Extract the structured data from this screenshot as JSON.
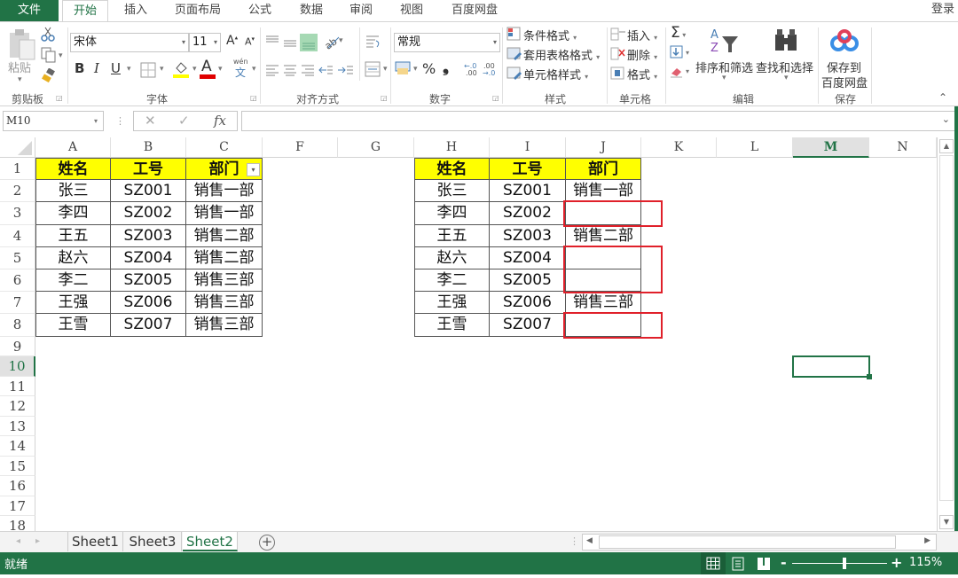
{
  "tabs": {
    "file": "文件",
    "items": [
      "开始",
      "插入",
      "页面布局",
      "公式",
      "数据",
      "审阅",
      "视图",
      "百度网盘"
    ],
    "active_index": 0,
    "login": "登录"
  },
  "ribbon": {
    "clipboard": {
      "paste": "粘贴",
      "label": "剪贴板"
    },
    "font": {
      "name": "宋体",
      "size": "11",
      "bold": "B",
      "italic": "I",
      "underline": "U",
      "label": "字体",
      "phonetic_top": "wén",
      "phonetic_bottom": "文",
      "grow": "A",
      "shrink": "A",
      "font_color_letter": "A"
    },
    "alignment": {
      "label": "对齐方式"
    },
    "number": {
      "format": "常规",
      "percent": "%",
      "comma": "❟",
      "label": "数字"
    },
    "styles": {
      "conditional": "条件格式",
      "table": "套用表格格式",
      "cell": "单元格样式",
      "label": "样式"
    },
    "cells": {
      "insert": "插入",
      "delete": "删除",
      "format": "格式",
      "label": "单元格"
    },
    "editing": {
      "sum": "Σ",
      "sort_filter": "排序和筛选",
      "find_select": "查找和选择",
      "label": "编辑"
    },
    "save": {
      "line1": "保存到",
      "line2": "百度网盘",
      "label": "保存"
    },
    "colors": {
      "highlight": "#ffff00",
      "font_color": "#e00000",
      "accent": "#217346"
    }
  },
  "formula_bar": {
    "name_box": "M10",
    "cancel": "✕",
    "enter": "✓",
    "fx": "fx",
    "value": ""
  },
  "columns": [
    "A",
    "B",
    "C",
    "F",
    "G",
    "H",
    "I",
    "J",
    "K",
    "L",
    "M",
    "N"
  ],
  "selected_column": "M",
  "rows": [
    "1",
    "2",
    "3",
    "4",
    "5",
    "6",
    "7",
    "8",
    "9",
    "10",
    "11",
    "12",
    "13",
    "14",
    "15",
    "16",
    "17",
    "18"
  ],
  "selected_row": "10",
  "table_left": {
    "headers": [
      "姓名",
      "工号",
      "部门"
    ],
    "rows": [
      [
        "张三",
        "SZ001",
        "销售一部"
      ],
      [
        "李四",
        "SZ002",
        "销售一部"
      ],
      [
        "王五",
        "SZ003",
        "销售二部"
      ],
      [
        "赵六",
        "SZ004",
        "销售二部"
      ],
      [
        "李二",
        "SZ005",
        "销售三部"
      ],
      [
        "王强",
        "SZ006",
        "销售三部"
      ],
      [
        "王雪",
        "SZ007",
        "销售三部"
      ]
    ],
    "filter_column": "部门"
  },
  "table_right": {
    "headers": [
      "姓名",
      "工号",
      "部门"
    ],
    "rows": [
      [
        "张三",
        "SZ001",
        "销售一部"
      ],
      [
        "李四",
        "SZ002",
        ""
      ],
      [
        "王五",
        "SZ003",
        "销售二部"
      ],
      [
        "赵六",
        "SZ004",
        ""
      ],
      [
        "李二",
        "SZ005",
        ""
      ],
      [
        "王强",
        "SZ006",
        "销售三部"
      ],
      [
        "王雪",
        "SZ007",
        ""
      ]
    ],
    "highlight_color": "#e0202a"
  },
  "sheets": {
    "items": [
      "Sheet1",
      "Sheet3",
      "Sheet2"
    ],
    "active": "Sheet2",
    "add": "+"
  },
  "status": {
    "ready": "就绪",
    "zoom": "115%",
    "zoom_fraction": 0.55
  }
}
